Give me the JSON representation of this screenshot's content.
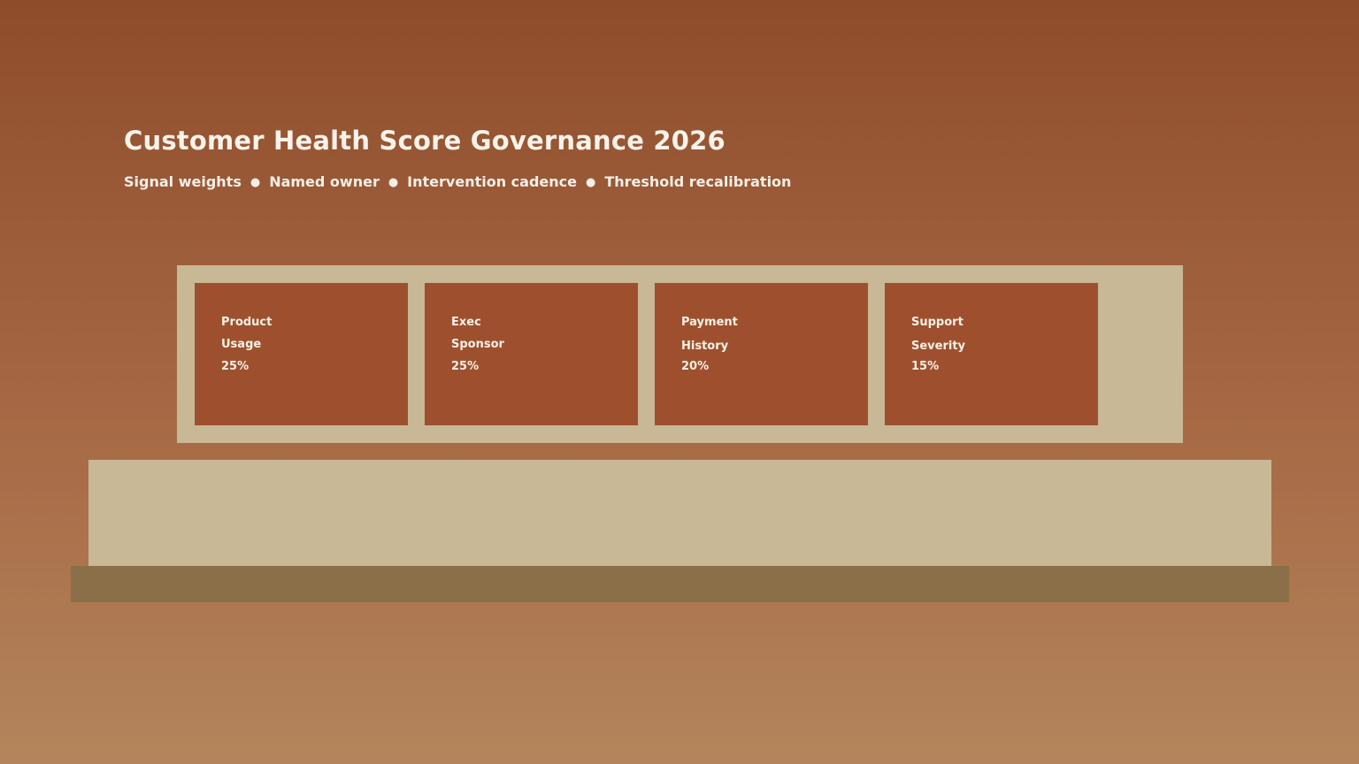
{
  "header": {
    "title": "Customer Health Score Governance 2026",
    "subtitle_items": [
      "Signal weights",
      "Named owner",
      "Intervention cadence",
      "Threshold recalibration"
    ],
    "separator": "●"
  },
  "signals": [
    {
      "line1": "Product",
      "line2": "Usage",
      "weight": "25%"
    },
    {
      "line1": "Exec",
      "line2": "Sponsor",
      "weight": "25%"
    },
    {
      "line1": "Payment",
      "line2": "History",
      "weight": "20%"
    },
    {
      "line1": "Support",
      "line2": "Severity",
      "weight": "15%"
    }
  ],
  "colors": {
    "background_top": "#8f4c2b",
    "background_bottom": "#b4855c",
    "card": "#9e502e",
    "platform": "#c8b895",
    "base": "#8b6f48"
  }
}
